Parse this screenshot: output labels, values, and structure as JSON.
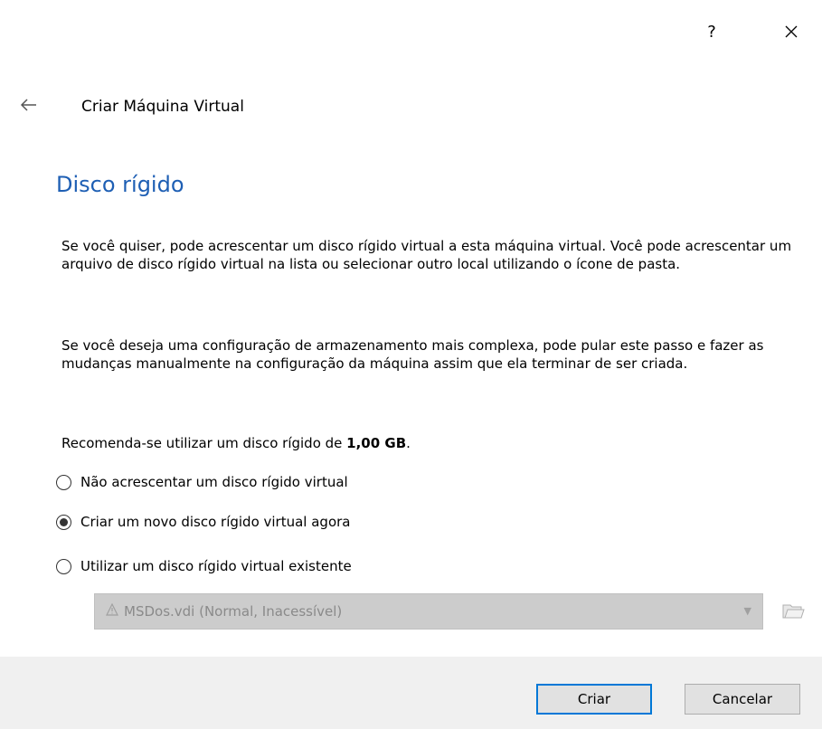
{
  "window": {
    "help_label": "?",
    "close_label": "✕"
  },
  "wizard": {
    "back_icon": "arrow-left-icon",
    "title": "Criar Máquina Virtual"
  },
  "page": {
    "section_title": "Disco rígido",
    "paragraph1": "Se você quiser, pode acrescentar um disco rígido virtual a esta máquina virtual. Você pode acrescentar um arquivo de disco rígido virtual na lista ou selecionar outro local utilizando o ícone de pasta.",
    "paragraph2": "Se você deseja uma configuração de armazenamento mais complexa, pode pular este passo e fazer as mudanças manualmente na configuração da máquina assim que ela terminar de ser criada.",
    "recommend_prefix": "Recomenda-se utilizar um disco rígido de ",
    "recommend_size": "1,00 GB",
    "recommend_suffix": "."
  },
  "options": [
    {
      "label": "Não acrescentar um disco rígido virtual",
      "checked": false
    },
    {
      "label": "Criar um novo disco rígido virtual agora",
      "checked": true
    },
    {
      "label": "Utilizar um disco rígido virtual existente",
      "checked": false
    }
  ],
  "disk_select": {
    "value": "MSDos.vdi (Normal, Inacessível)",
    "enabled": false
  },
  "buttons": {
    "create": "Criar",
    "cancel": "Cancelar"
  },
  "colors": {
    "accent": "#1e5fb4",
    "default_button_border": "#0078d7",
    "footer_bg": "#f0f0f0"
  }
}
